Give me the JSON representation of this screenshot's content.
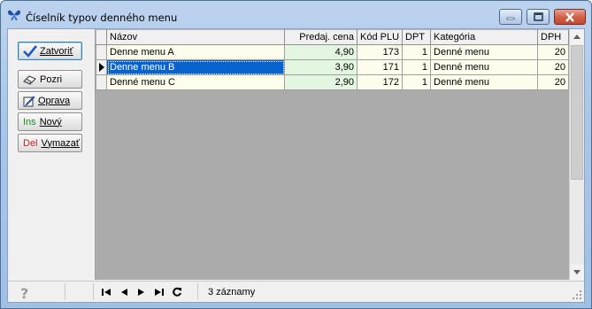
{
  "window": {
    "title": "Číselník typov denného menu",
    "app_icon": "butterfly-icon",
    "controls": [
      "minimize-icon",
      "maximize-icon",
      "close-icon"
    ]
  },
  "toolbar": {
    "close_label": "Zatvoriť",
    "view_label": "Pozri",
    "edit_label": "Oprava",
    "new_prefix": "Ins",
    "new_label": "Nový",
    "delete_prefix": "Del",
    "delete_label": "Vymazať"
  },
  "grid": {
    "columns": [
      "Názov",
      "Predaj. cena",
      "Kód PLU",
      "DPT",
      "Kategória",
      "DPH"
    ],
    "rows": [
      [
        "Denne menu A",
        "4,90",
        "173",
        "1",
        "Denné menu",
        "20"
      ],
      [
        "Denne menu B",
        "3,90",
        "171",
        "1",
        "Denné menu",
        "20"
      ],
      [
        "Denné menu C",
        "2,90",
        "172",
        "1",
        "Denné menu",
        "20"
      ]
    ],
    "selected_row": 1
  },
  "status": {
    "records_label": "3 záznamy",
    "nav_icons": [
      "first-record-icon",
      "prev-record-icon",
      "next-record-icon",
      "last-record-icon",
      "refresh-icon"
    ],
    "help_icon": "help-icon"
  },
  "colors": {
    "selection": "#0a63cc",
    "row_background": "#fefcea",
    "price_background": "#e3f6e0",
    "title_bar": "#a9c6e8"
  }
}
